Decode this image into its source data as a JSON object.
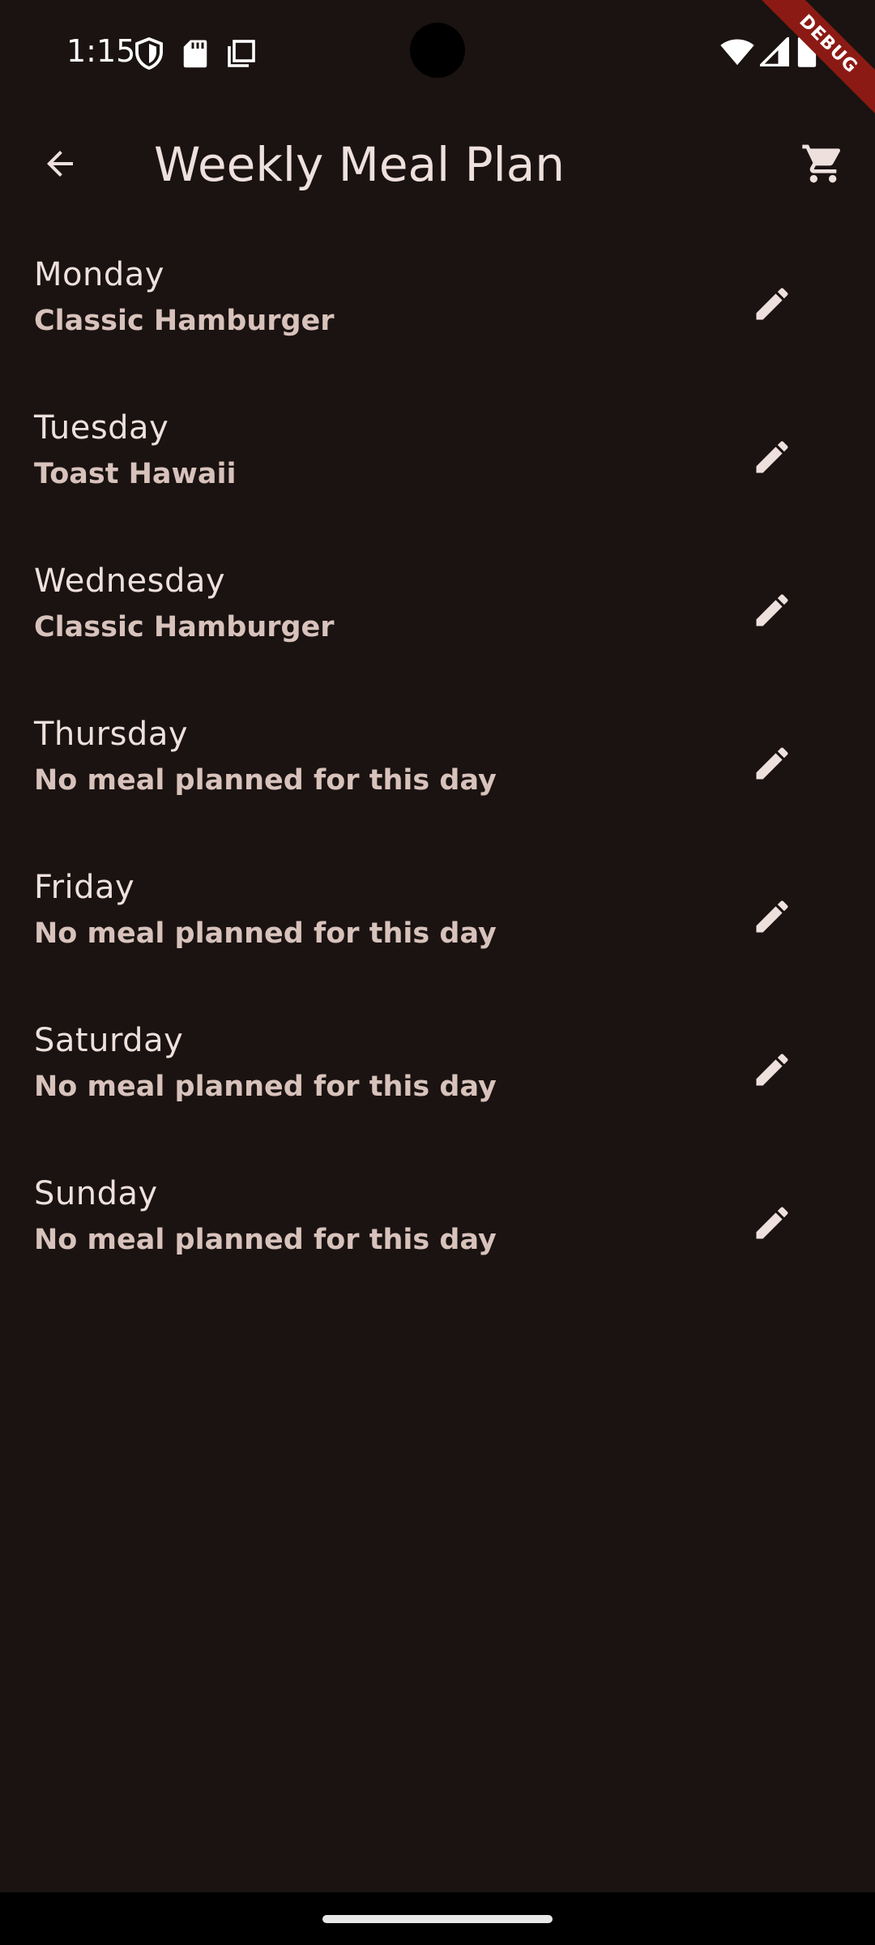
{
  "status_bar": {
    "time": "1:15",
    "icons": [
      "vpn-shield-icon",
      "sd-card-icon",
      "screenshot-icon",
      "wifi-icon",
      "cell-signal-icon",
      "battery-icon"
    ]
  },
  "debug_banner": "DEBUG",
  "app_bar": {
    "title": "Weekly Meal Plan",
    "back_icon": "arrow-back-icon",
    "cart_icon": "shopping-cart-icon"
  },
  "days": [
    {
      "day": "Monday",
      "meal": "Classic Hamburger"
    },
    {
      "day": "Tuesday",
      "meal": "Toast Hawaii"
    },
    {
      "day": "Wednesday",
      "meal": "Classic Hamburger"
    },
    {
      "day": "Thursday",
      "meal": "No meal planned for this day"
    },
    {
      "day": "Friday",
      "meal": "No meal planned for this day"
    },
    {
      "day": "Saturday",
      "meal": "No meal planned for this day"
    },
    {
      "day": "Sunday",
      "meal": "No meal planned for this day"
    }
  ],
  "colors": {
    "background": "#1a1311",
    "text_primary": "#eee0dc",
    "text_secondary": "#d8c2bc",
    "debug_ribbon": "#8c1a14"
  }
}
